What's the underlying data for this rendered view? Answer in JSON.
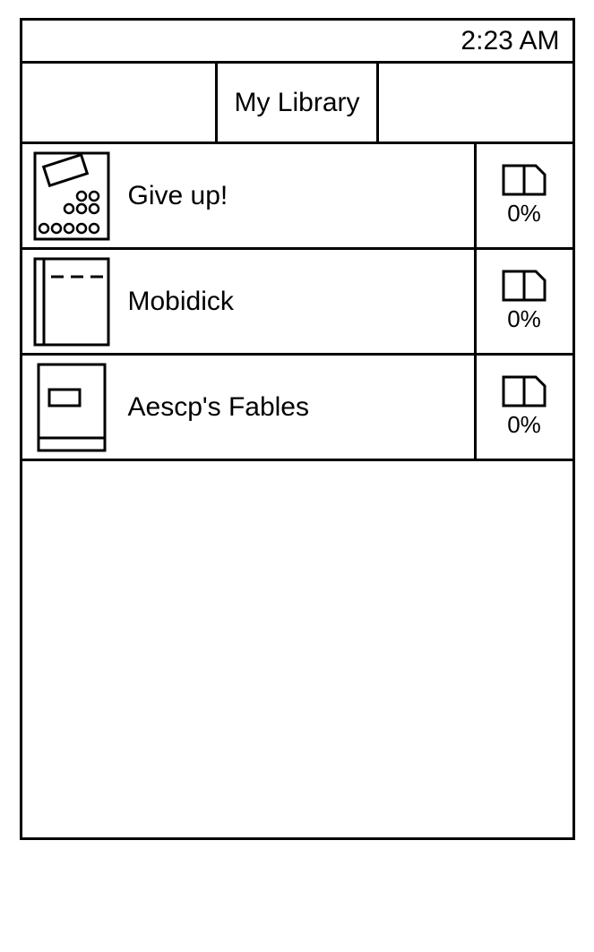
{
  "status_bar": {
    "time": "2:23 AM"
  },
  "header": {
    "title": "My Library"
  },
  "library": {
    "items": [
      {
        "title": "Give up!",
        "progress": "0%"
      },
      {
        "title": "Mobidick",
        "progress": "0%"
      },
      {
        "title": "Aescp's Fables",
        "progress": "0%"
      }
    ]
  }
}
